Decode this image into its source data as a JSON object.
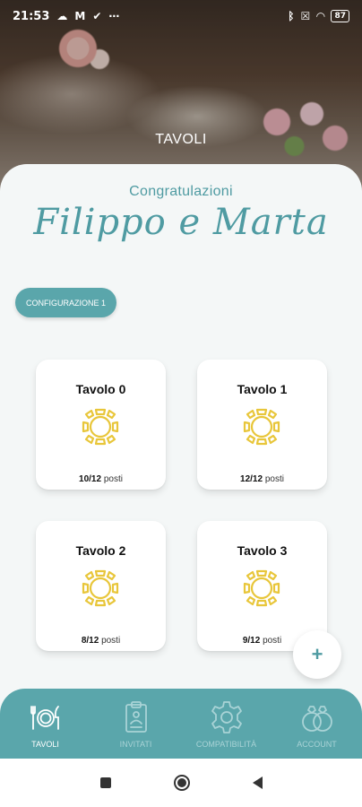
{
  "status_bar": {
    "time": "21:53",
    "battery": "87"
  },
  "hero": {
    "title": "TAVOLI"
  },
  "header": {
    "congrats": "Congratulazioni",
    "couple": "Filippo e Marta"
  },
  "config_button": {
    "label": "CONFIGURAZIONE 1"
  },
  "tables": [
    {
      "name": "Tavolo 0",
      "occupied": "10/12",
      "unit": "posti"
    },
    {
      "name": "Tavolo 1",
      "occupied": "12/12",
      "unit": "posti"
    },
    {
      "name": "Tavolo 2",
      "occupied": "8/12",
      "unit": "posti"
    },
    {
      "name": "Tavolo 3",
      "occupied": "9/12",
      "unit": "posti"
    }
  ],
  "fab": {
    "label": "+"
  },
  "bottom_nav": [
    {
      "label": "TAVOLI",
      "icon": "cutlery-icon",
      "active": true
    },
    {
      "label": "INVITATI",
      "icon": "clipboard-icon",
      "active": false
    },
    {
      "label": "COMPATIBILITÀ",
      "icon": "gear-icon",
      "active": false
    },
    {
      "label": "ACCOUNT",
      "icon": "rings-icon",
      "active": false
    }
  ],
  "colors": {
    "accent": "#5aa6ab",
    "text_accent": "#4f9ba2",
    "table_icon": "#e8c63a"
  }
}
